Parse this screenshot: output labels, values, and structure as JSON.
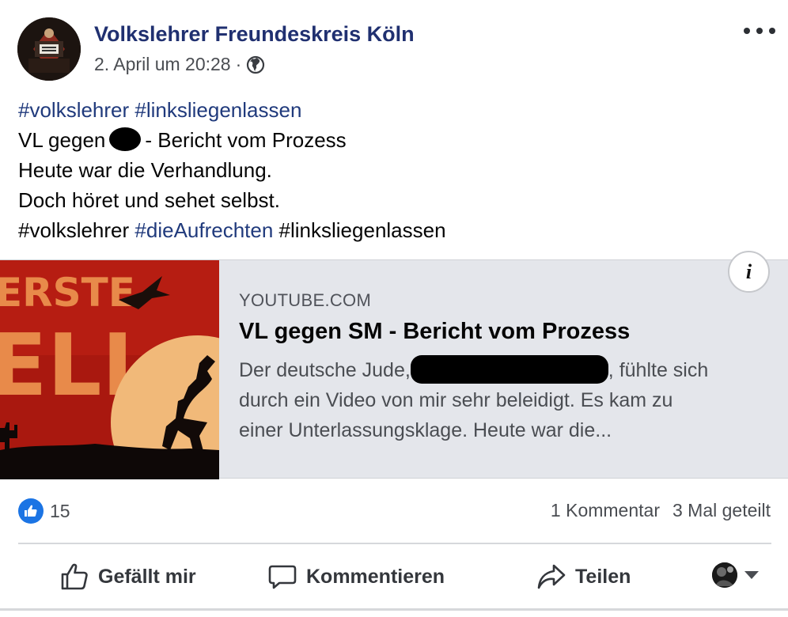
{
  "header": {
    "page_name": "Volkslehrer Freundeskreis Köln",
    "date": "2. April um 20:28",
    "separator": "·",
    "privacy_icon": "globe-icon",
    "more_icon": "more-dots-icon"
  },
  "post": {
    "lines": [
      [
        {
          "text": "#volkslehrer",
          "tag": true
        },
        {
          "text": " ",
          "tag": false
        },
        {
          "text": "#linksliegenlassen",
          "tag": true
        }
      ],
      [
        {
          "text": "VL gegen",
          "tag": false
        }
      ],
      [
        {
          "text": "Heute war die Verhandlung.",
          "tag": false
        }
      ],
      [
        {
          "text": "Doch höret und sehet selbst.",
          "tag": false
        }
      ],
      [
        {
          "text": "#volkslehrer",
          "tag": false
        },
        {
          "text": " ",
          "tag": false
        },
        {
          "text": "#dieAufrechten",
          "tag": true
        },
        {
          "text": " #linksliegenlassen",
          "tag": false
        }
      ]
    ],
    "line2_suffix": "- Bericht vom Prozess"
  },
  "link_card": {
    "domain": "YOUTUBE.COM",
    "title": "VL gegen SM - Bericht vom Prozess",
    "desc_line1_prefix": "Der deutsche Jude,",
    "desc_line1_suffix": ", fühlte sich",
    "desc_line2": "durch ein Video von mir sehr beleidigt. Es kam zu",
    "desc_line3": "einer Unterlassungsklage. Heute war die...",
    "info_label": "i",
    "thumbnail_text_top": "ERSTE",
    "thumbnail_text_bottom": "ELL"
  },
  "engagement": {
    "like_count": "15",
    "comments": "1 Kommentar",
    "shares": "3 Mal geteilt",
    "like_color": "#1b74e4"
  },
  "actions": {
    "like": "Gefällt mir",
    "comment": "Kommentieren",
    "share": "Teilen"
  }
}
